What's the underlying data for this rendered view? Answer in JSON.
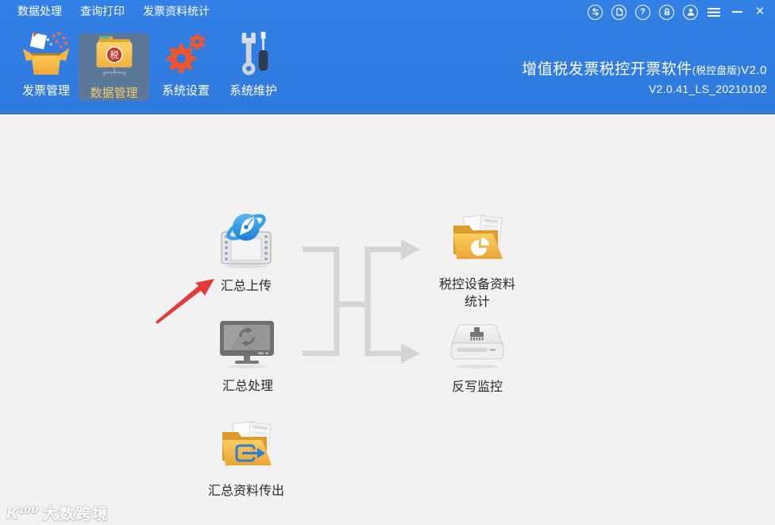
{
  "window": {
    "title": "增值税发票税控开票软件",
    "title_edition": "(税控盘版)",
    "title_version": "V2.0",
    "version_line": "V2.0.41_LS_20210102"
  },
  "menubar": {
    "items": [
      {
        "label": "数据处理"
      },
      {
        "label": "查询打印"
      },
      {
        "label": "发票资料统计"
      }
    ]
  },
  "titlebar": {
    "help_glyph": "?",
    "close_glyph": "×",
    "icons": [
      "transfer-icon",
      "note-icon",
      "help-icon",
      "lock-icon",
      "user-icon",
      "hamburger-icon",
      "minimize-icon",
      "close-icon"
    ]
  },
  "toolbar": {
    "tax_seal_char": "税",
    "items": [
      {
        "label": "发票管理",
        "icon": "open-box-icon",
        "selected": false
      },
      {
        "label": "数据管理",
        "icon": "tax-folder-icon",
        "selected": true
      },
      {
        "label": "系统设置",
        "icon": "gears-icon",
        "selected": false
      },
      {
        "label": "系统维护",
        "icon": "tools-icon",
        "selected": false
      }
    ]
  },
  "content": {
    "features": [
      {
        "label": "汇总上传",
        "icon": "globe-pen-icon"
      },
      {
        "label": "税控设备资料统计",
        "icon": "folder-pie-icon"
      },
      {
        "label": "汇总处理",
        "icon": "monitor-refresh-icon"
      },
      {
        "label": "反写监控",
        "icon": "drive-brush-icon"
      },
      {
        "label": "汇总资料传出",
        "icon": "folder-export-icon"
      }
    ]
  },
  "watermark": {
    "logo": "K¹⁰⁰",
    "text": "大数跨境"
  },
  "colors": {
    "header_blue": "#3079e2",
    "selected_tab": "#5b7899",
    "selected_label_gold": "#f3c96b",
    "content_bg": "#f2f2f2",
    "flow_arrow_gray": "#d5d5d5",
    "annotation_red": "#e23b38",
    "folder_gold": "#f2b140"
  }
}
